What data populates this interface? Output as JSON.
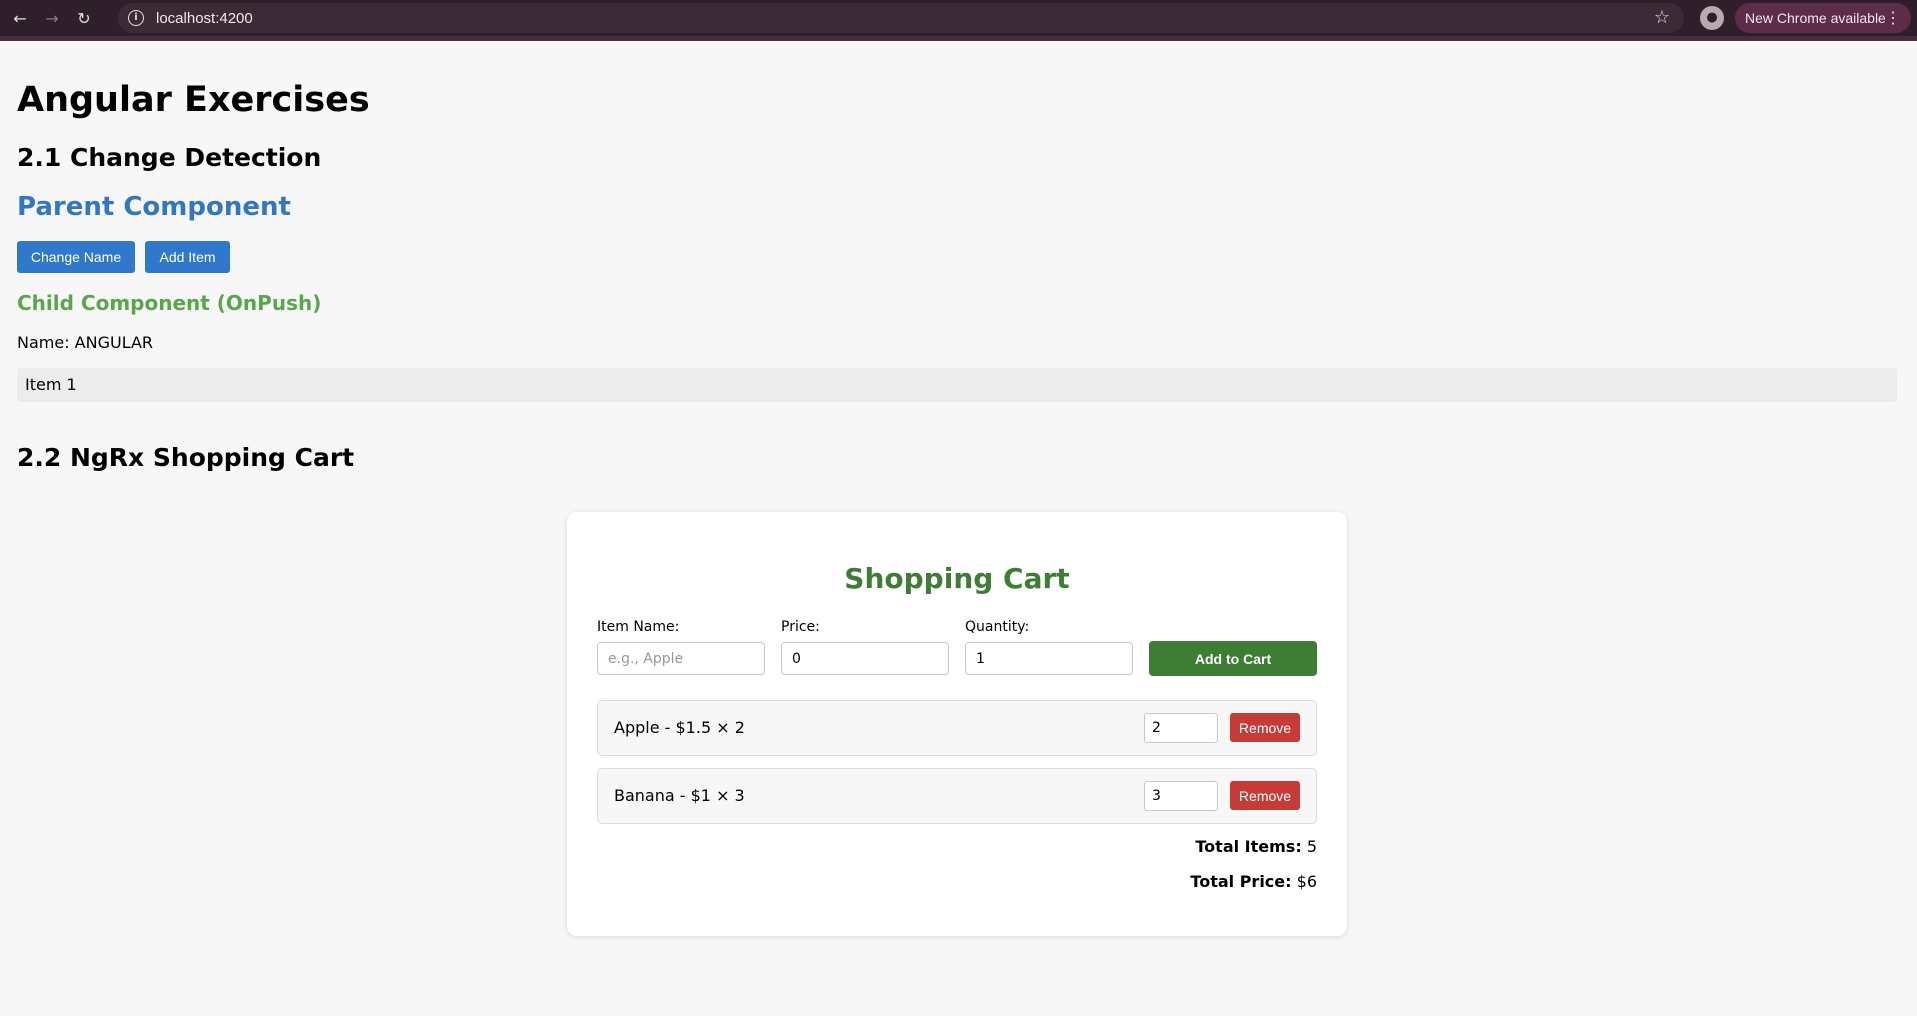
{
  "browser": {
    "url": "localhost:4200",
    "update_label": "New Chrome available"
  },
  "page": {
    "title": "Angular Exercises",
    "section1_title": "2.1 Change Detection",
    "parent_title": "Parent Component",
    "change_name_label": "Change Name",
    "add_item_label": "Add Item",
    "child_title": "Child Component (OnPush)",
    "name_line": "Name: ANGULAR",
    "items": [
      "Item 1"
    ],
    "section2_title": "2.2 NgRx Shopping Cart"
  },
  "cart": {
    "title": "Shopping Cart",
    "item_name_label": "Item Name:",
    "item_name_placeholder": "e.g., Apple",
    "price_label": "Price:",
    "price_value": "0",
    "quantity_label": "Quantity:",
    "quantity_value": "1",
    "add_label": "Add to Cart",
    "items": [
      {
        "desc": "Apple - $1.5 × 2",
        "qty": "2",
        "remove_label": "Remove"
      },
      {
        "desc": "Banana - $1 × 3",
        "qty": "3",
        "remove_label": "Remove"
      }
    ],
    "total_items_label": "Total Items:",
    "total_items": "5",
    "total_price_label": "Total Price:",
    "total_price": "$6"
  },
  "colors": {
    "primary_blue": "#2f78cc",
    "child_green": "#5aa64a",
    "cart_green": "#3e7d34",
    "remove_red": "#c63b36"
  }
}
